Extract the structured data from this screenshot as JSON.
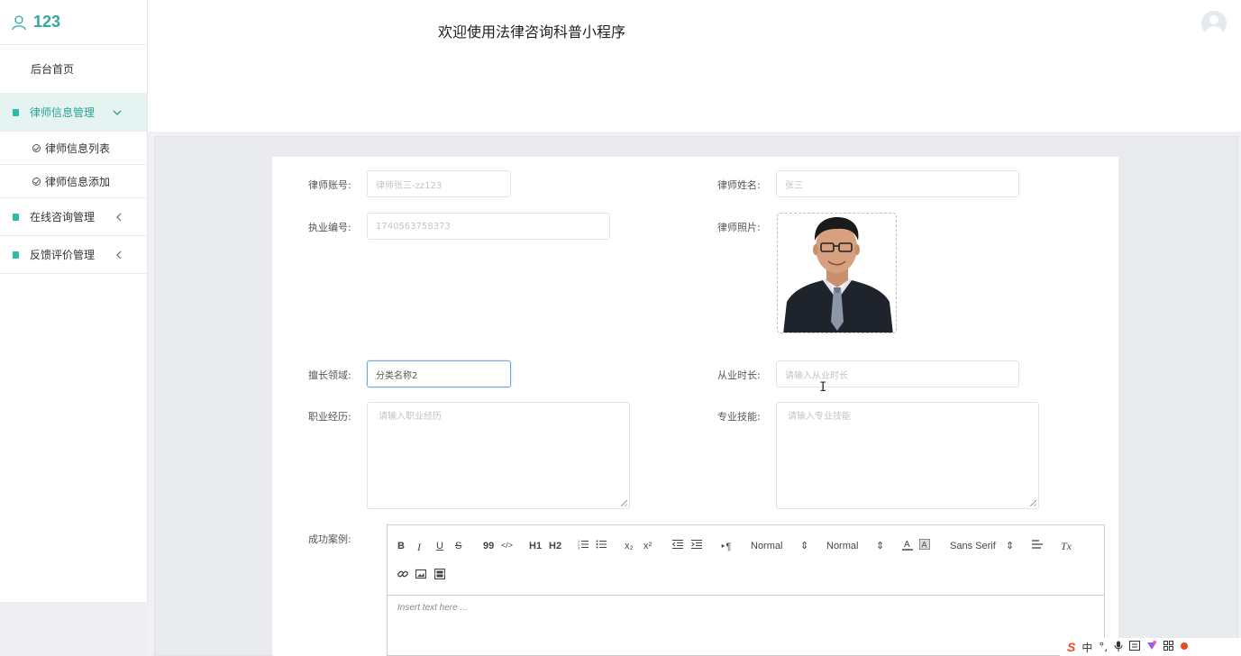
{
  "sidebar": {
    "username": "123",
    "home": "后台首页",
    "groups": [
      {
        "label": "律师信息管理",
        "expanded": true,
        "sub": [
          "律师信息列表",
          "律师信息添加"
        ]
      },
      {
        "label": "在线咨询管理",
        "expanded": false
      },
      {
        "label": "反馈评价管理",
        "expanded": false
      }
    ]
  },
  "header": {
    "title": "欢迎使用法律咨询科普小程序"
  },
  "form": {
    "account": {
      "label": "律师账号:",
      "placeholder": "律师张三-zz123"
    },
    "name": {
      "label": "律师姓名:",
      "placeholder": "张三"
    },
    "license": {
      "label": "执业编号:",
      "placeholder": "1740563758373"
    },
    "photo": {
      "label": "律师照片:"
    },
    "specialty": {
      "label": "擅长领域:",
      "value": "分类名称2"
    },
    "years": {
      "label": "从业时长:",
      "placeholder": "请输入从业时长"
    },
    "experience": {
      "label": "职业经历:",
      "placeholder": "请输入职业经历"
    },
    "skills": {
      "label": "专业技能:",
      "placeholder": "请输入专业技能"
    },
    "cases": {
      "label": "成功案例:"
    }
  },
  "editor": {
    "toolbar": {
      "bold": "B",
      "italic": "I",
      "underline": "U",
      "strike": "S",
      "quote": "99",
      "code": "</>",
      "h1": "H1",
      "h2": "H2",
      "sub": "x₂",
      "sup": "x²",
      "pilcrow": "¶",
      "size": "Normal",
      "header": "Normal",
      "font": "Sans Serif",
      "clear": "Tx"
    },
    "placeholder": "Insert text here ..."
  },
  "ime": {
    "logo": "S",
    "lang": "中"
  },
  "colors": {
    "accent": "#31a8a0",
    "active_bg": "#e6f4f1",
    "focus_border": "#6ea6e0"
  }
}
